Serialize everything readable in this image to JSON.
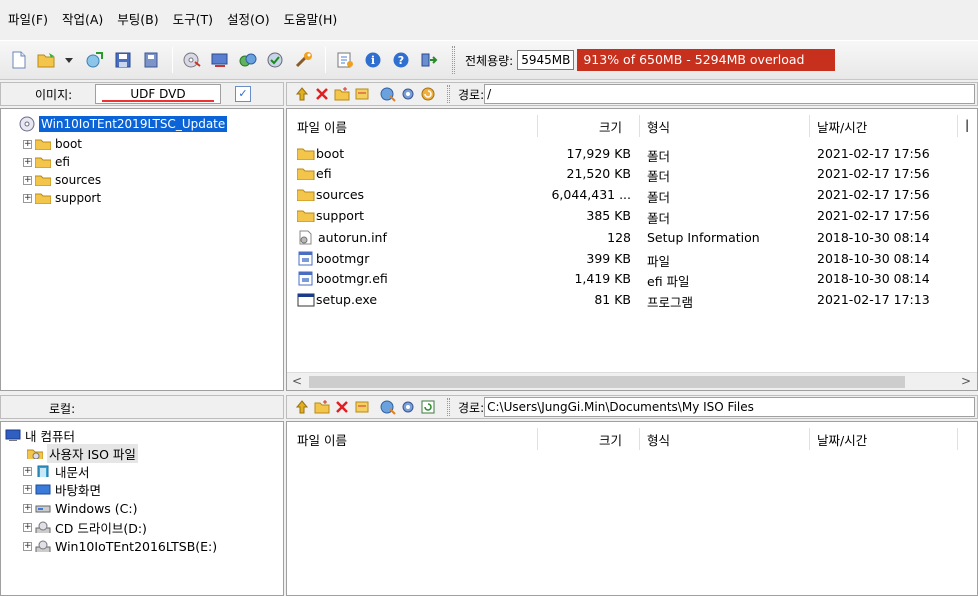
{
  "menu": {
    "items": [
      "파일(F)",
      "작업(A)",
      "부팅(B)",
      "도구(T)",
      "설정(O)",
      "도움말(H)"
    ]
  },
  "toolbar": {
    "capacity_label": "전체용량:",
    "capacity_value": "5945MB",
    "capacity_status": "913% of 650MB - 5294MB overload",
    "capacity_percent": 913,
    "overload_color": "#c8301e",
    "icons": [
      "new-icon",
      "open-icon",
      "dropdown-icon",
      "extract-icon",
      "save-icon",
      "save-as-icon",
      "burn-icon",
      "mount-icon",
      "compress-icon",
      "checksum-icon",
      "wizard-icon",
      "properties-icon",
      "info-icon",
      "help-icon",
      "exit-icon"
    ]
  },
  "image_pane": {
    "label": "이미지:",
    "type_value": "UDF DVD",
    "root": "Win10IoTEnt2019LTSC_Update",
    "folders": [
      "boot",
      "efi",
      "sources",
      "support"
    ],
    "path_label": "경로:",
    "path_value": "/"
  },
  "columns": {
    "name": "파일 이름",
    "size": "크기",
    "type": "형식",
    "date": "날짜/시간"
  },
  "image_files": [
    {
      "name": "boot",
      "size": "17,929 KB",
      "type": "폴더",
      "date": "2021-02-17 17:56",
      "icon": "folder-icon"
    },
    {
      "name": "efi",
      "size": "21,520 KB",
      "type": "폴더",
      "date": "2021-02-17 17:56",
      "icon": "folder-icon"
    },
    {
      "name": "sources",
      "size": "6,044,431 ...",
      "type": "폴더",
      "date": "2021-02-17 17:56",
      "icon": "folder-icon"
    },
    {
      "name": "support",
      "size": "385 KB",
      "type": "폴더",
      "date": "2021-02-17 17:56",
      "icon": "folder-icon"
    },
    {
      "name": "autorun.inf",
      "size": "128",
      "type": "Setup Information",
      "date": "2018-10-30 08:14",
      "icon": "inf-file-icon"
    },
    {
      "name": "bootmgr",
      "size": "399 KB",
      "type": "파일",
      "date": "2018-10-30 08:14",
      "icon": "file-icon"
    },
    {
      "name": "bootmgr.efi",
      "size": "1,419 KB",
      "type": "efi 파일",
      "date": "2018-10-30 08:14",
      "icon": "file-icon"
    },
    {
      "name": "setup.exe",
      "size": "81 KB",
      "type": "프로그램",
      "date": "2021-02-17 17:13",
      "icon": "exe-icon"
    }
  ],
  "local_pane": {
    "label": "로컬:",
    "path_label": "경로:",
    "path_value": "C:\\Users\\JungGi.Min\\Documents\\My ISO Files",
    "tree": [
      {
        "label": "내 컴퓨터",
        "icon": "computer-icon"
      },
      {
        "label": "사용자 ISO 파일",
        "icon": "iso-folder-icon"
      },
      {
        "label": "내문서",
        "icon": "documents-icon"
      },
      {
        "label": "바탕화면",
        "icon": "desktop-icon"
      },
      {
        "label": "Windows (C:)",
        "icon": "hard-drive-icon"
      },
      {
        "label": "CD 드라이브(D:)",
        "icon": "cd-drive-icon"
      },
      {
        "label": "Win10IoTEnt2016LTSB(E:)",
        "icon": "cd-drive-icon"
      }
    ]
  }
}
